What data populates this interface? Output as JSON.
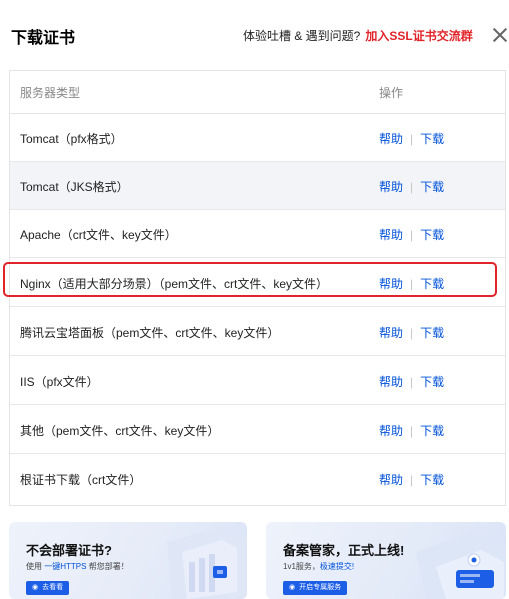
{
  "header": {
    "title": "下载证书",
    "feedback_text": "体验吐槽 & 遇到问题?",
    "feedback_link": "加入SSL证书交流群"
  },
  "table": {
    "col_type": "服务器类型",
    "col_ops": "操作",
    "help_label": "帮助",
    "separator": "|",
    "download_label": "下载",
    "rows": [
      {
        "name": "Tomcat（pfx格式）"
      },
      {
        "name": "Tomcat（JKS格式）"
      },
      {
        "name": "Apache（crt文件、key文件）"
      },
      {
        "name": "Nginx（适用大部分场景）（pem文件、crt文件、key文件）"
      },
      {
        "name": "腾讯云宝塔面板（pem文件、crt文件、key文件）"
      },
      {
        "name": "IIS（pfx文件）"
      },
      {
        "name": "其他（pem文件、crt文件、key文件）"
      },
      {
        "name": "根证书下载（crt文件）"
      }
    ]
  },
  "banners": [
    {
      "title": "不会部署证书?",
      "sub_prefix": "使用 ",
      "sub_highlight": "一键HTTPS",
      "sub_suffix": " 帮您部署！",
      "button": "去看看"
    },
    {
      "title": "备案管家，正式上线!",
      "sub_prefix": "1v1服务，",
      "sub_highlight": "极速提交!",
      "sub_suffix": "",
      "button": "开启专属服务"
    }
  ],
  "colors": {
    "accent": "#0052d9",
    "highlight_border": "#e0242a",
    "alt_row": "#f2f4f8"
  }
}
